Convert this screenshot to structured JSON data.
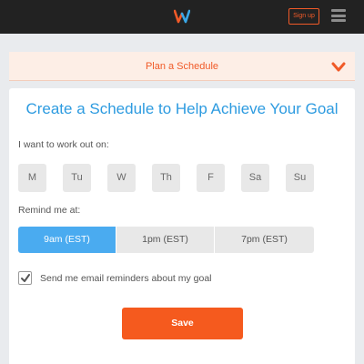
{
  "header": {
    "logo_icon": "w-logo-icon",
    "signup_label": "Sign up",
    "menu_icon": "hamburger-menu-icon",
    "accent_color": "#f05a28"
  },
  "plan": {
    "title": "Plan a Schedule",
    "chevron_icon": "chevron-down-icon"
  },
  "form": {
    "title": "Create a Schedule to Help Achieve Your Goal",
    "workout_label": "I want to work out on:",
    "days": [
      "M",
      "Tu",
      "W",
      "Th",
      "F",
      "Sa",
      "Su"
    ],
    "remind_label": "Remind me at:",
    "times": [
      "9am (EST)",
      "1pm (EST)",
      "7pm (EST)"
    ],
    "selected_time": "9am (EST)",
    "email_reminder_label": "Send me email reminders about my goal",
    "email_reminder_checked": true,
    "save_label": "Save",
    "title_color": "#2d9be0",
    "selected_color": "#4aabf0",
    "save_color": "#f55a1e"
  }
}
